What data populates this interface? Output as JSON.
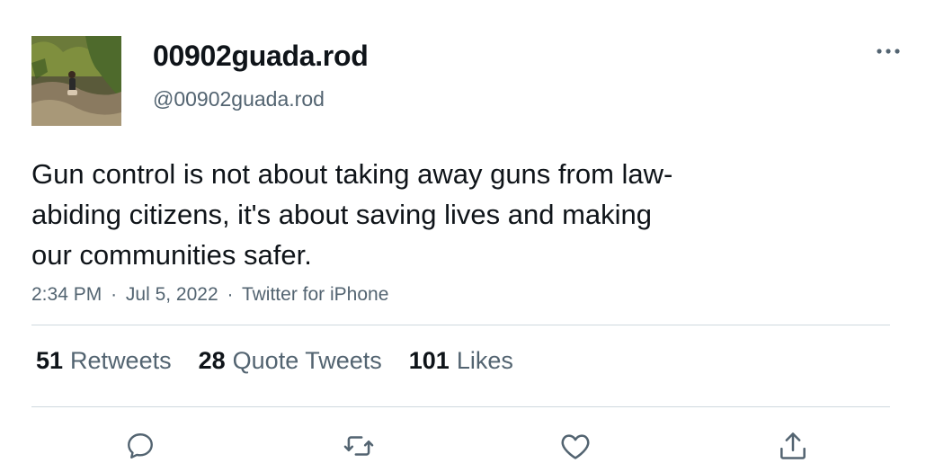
{
  "user": {
    "display_name": "00902guada.rod",
    "handle": "@00902guada.rod",
    "avatar_icon": "profile-photo"
  },
  "more_icon": "ellipsis-icon",
  "tweet": {
    "lines": [
      "Gun control is not about taking away guns from law-",
      "abiding citizens, it's about saving lives and making",
      "our communities safer."
    ]
  },
  "meta": {
    "time": "2:34 PM",
    "date": "Jul 5, 2022",
    "source": "Twitter for iPhone",
    "separator": "·"
  },
  "stats": {
    "retweets": {
      "count": "51",
      "label": "Retweets"
    },
    "quotes": {
      "count": "28",
      "label": "Quote Tweets"
    },
    "likes": {
      "count": "101",
      "label": "Likes"
    }
  },
  "actions": [
    "reply-icon",
    "retweet-icon",
    "like-icon",
    "share-icon"
  ],
  "colors": {
    "text": "#0f1419",
    "secondary": "#536471",
    "divider": "#cfd9de"
  }
}
